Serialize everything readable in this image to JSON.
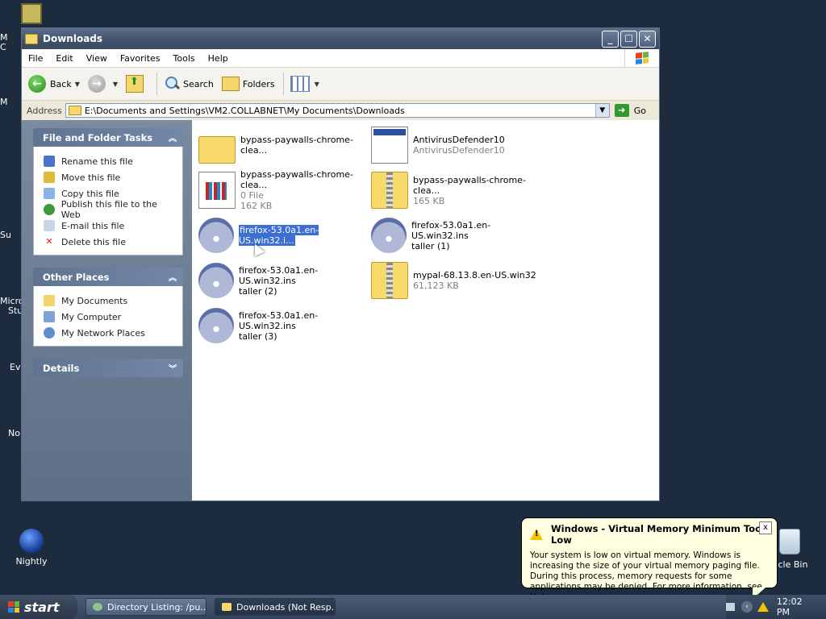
{
  "desktop": {
    "edge_labels": [
      "M",
      "C",
      "M",
      "Su",
      "Micro",
      "Stu",
      "Ev",
      "No"
    ],
    "nightly_label": "Nightly",
    "recycle_label": "ycle Bin"
  },
  "window": {
    "title": "Downloads",
    "controls": {
      "minimize": "_",
      "maximize": "☐",
      "close": "✕"
    }
  },
  "menubar": [
    "File",
    "Edit",
    "View",
    "Favorites",
    "Tools",
    "Help"
  ],
  "toolbar": {
    "back": "Back",
    "search": "Search",
    "folders": "Folders"
  },
  "address": {
    "label": "Address",
    "value": "E:\\Documents and Settings\\VM2.COLLABNET\\My Documents\\Downloads",
    "go": "Go"
  },
  "tasks": {
    "title": "File and Folder Tasks",
    "items": [
      "Rename this file",
      "Move this file",
      "Copy this file",
      "Publish this file to the Web",
      "E-mail this file",
      "Delete this file"
    ]
  },
  "other_places": {
    "title": "Other Places",
    "items": [
      "My Documents",
      "My Computer",
      "My Network Places"
    ]
  },
  "details": {
    "title": "Details"
  },
  "files": [
    {
      "name": "bypass-paywalls-chrome-clea...",
      "sub1": "",
      "sub2": "",
      "icon": "folder-icon"
    },
    {
      "name": "AntivirusDefender10",
      "sub1": "AntivirusDefender10",
      "sub2": "",
      "icon": "application-icon"
    },
    {
      "name": "bypass-paywalls-chrome-clea...",
      "sub1": "0 File",
      "sub2": "162 KB",
      "icon": "document-icon"
    },
    {
      "name": "bypass-paywalls-chrome-clea...",
      "sub1": "165 KB",
      "sub2": "",
      "icon": "zip-folder-icon"
    },
    {
      "name": "firefox-53.0a1.en-US.win32.i...",
      "sub1": "",
      "sub2": "",
      "icon": "installer-icon",
      "selected": true
    },
    {
      "name": "firefox-53.0a1.en-US.win32.ins",
      "sub1": "taller (1)",
      "sub2": "",
      "icon": "installer-icon"
    },
    {
      "name": "firefox-53.0a1.en-US.win32.ins",
      "sub1": "taller (2)",
      "sub2": "",
      "icon": "installer-icon"
    },
    {
      "name": "mypal-68.13.8.en-US.win32",
      "sub1": "61,123 KB",
      "sub2": "",
      "icon": "zip-folder-icon"
    },
    {
      "name": "firefox-53.0a1.en-US.win32.ins",
      "sub1": "taller (3)",
      "sub2": "",
      "icon": "installer-icon"
    }
  ],
  "balloon": {
    "title": "Windows - Virtual Memory Minimum Too Low",
    "message": "Your system is low on virtual memory. Windows is increasing the size of your virtual memory paging file. During this process, memory requests for some applications may be denied. For more information, see Help.",
    "close": "x"
  },
  "taskbar": {
    "start": "start",
    "tasks": [
      "Directory Listing: /pu...",
      "Downloads (Not Resp..."
    ],
    "clock": "12:02 PM"
  }
}
